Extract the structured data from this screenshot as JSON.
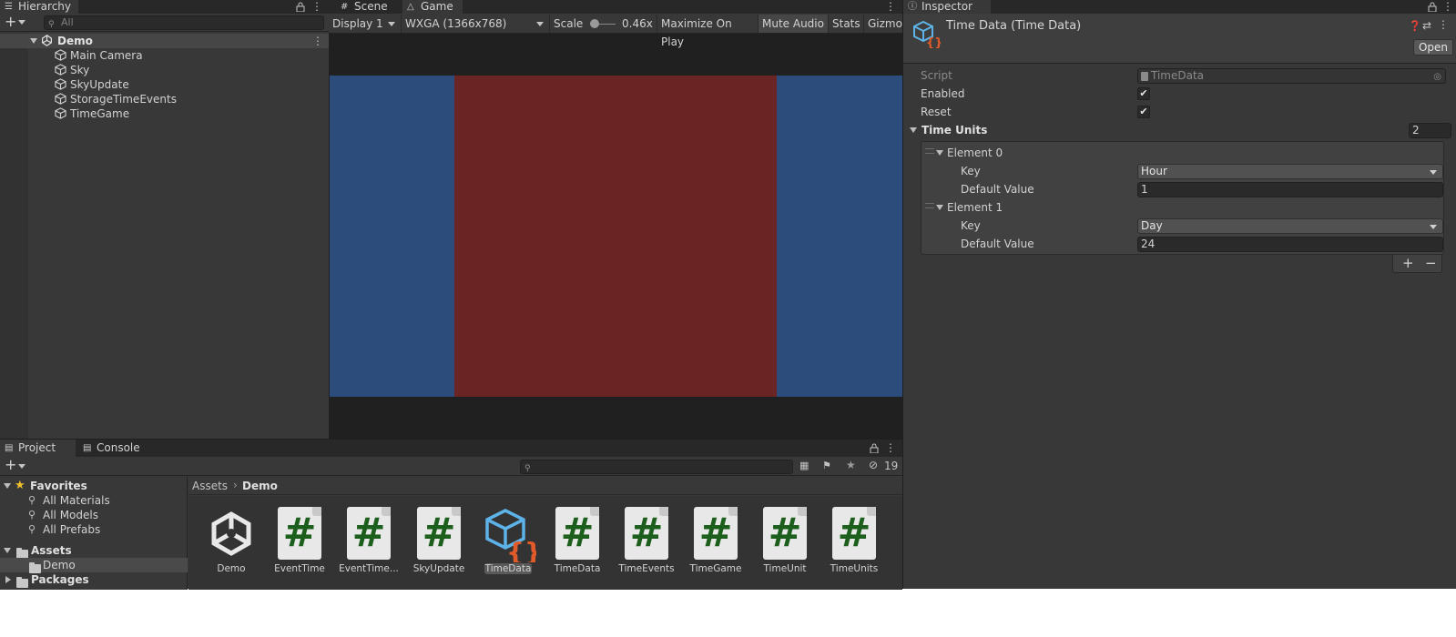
{
  "hierarchy": {
    "tab_label": "Hierarchy",
    "search_placeholder": "All",
    "scene_name": "Demo",
    "items": [
      "Main Camera",
      "Sky",
      "SkyUpdate",
      "StorageTimeEvents",
      "TimeGame"
    ]
  },
  "game_view": {
    "tabs": [
      "Scene",
      "Game"
    ],
    "display": "Display 1",
    "resolution": "WXGA (1366x768)",
    "scale_label": "Scale",
    "scale_value": "0.46x",
    "maximize_on_play": "Maximize On Play",
    "mute_audio": "Mute Audio",
    "stats": "Stats",
    "gizmos": "Gizmos",
    "colors": {
      "side": "#2c4c7c",
      "center": "#6a2424"
    }
  },
  "inspector": {
    "tab_label": "Inspector",
    "title": "Time Data (Time Data)",
    "open_button": "Open",
    "script_label": "Script",
    "script_value": "TimeData",
    "enabled_label": "Enabled",
    "enabled": true,
    "reset_label": "Reset",
    "reset": true,
    "time_units_label": "Time Units",
    "time_units_count": "2",
    "elements": [
      {
        "name": "Element 0",
        "key_label": "Key",
        "key_value": "Hour",
        "default_label": "Default Value",
        "default_value": "1"
      },
      {
        "name": "Element 1",
        "key_label": "Key",
        "key_value": "Day",
        "default_label": "Default Value",
        "default_value": "24"
      }
    ],
    "add_symbol": "+",
    "remove_symbol": "−"
  },
  "project": {
    "tabs": [
      "Project",
      "Console"
    ],
    "hidden_count": "19",
    "favorites_label": "Favorites",
    "favorites": [
      "All Materials",
      "All Models",
      "All Prefabs"
    ],
    "assets_label": "Assets",
    "assets_children": [
      "Demo"
    ],
    "packages_label": "Packages",
    "breadcrumb": [
      "Assets",
      "Demo"
    ],
    "items": [
      {
        "name": "Demo",
        "icon": "unity-scene-icon"
      },
      {
        "name": "EventTime",
        "icon": "csharp-script-icon"
      },
      {
        "name": "EventTime...",
        "icon": "csharp-script-icon"
      },
      {
        "name": "SkyUpdate",
        "icon": "csharp-script-icon"
      },
      {
        "name": "TimeData",
        "icon": "scriptable-object-icon",
        "selected": true
      },
      {
        "name": "TimeData",
        "icon": "csharp-script-icon"
      },
      {
        "name": "TimeEvents",
        "icon": "csharp-script-icon"
      },
      {
        "name": "TimeGame",
        "icon": "csharp-script-icon"
      },
      {
        "name": "TimeUnit",
        "icon": "csharp-script-icon"
      },
      {
        "name": "TimeUnits",
        "icon": "csharp-script-icon"
      }
    ]
  }
}
